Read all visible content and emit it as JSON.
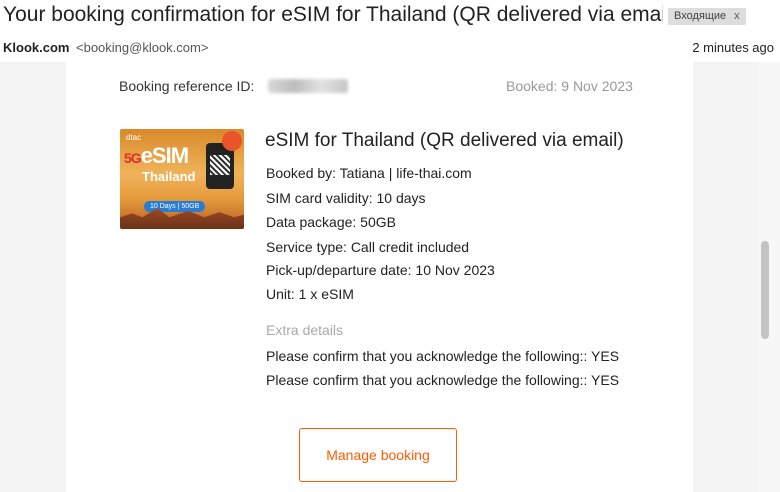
{
  "email": {
    "subject": "Your booking confirmation for eSIM for Thailand (QR delivered via email…",
    "label": "Входящие",
    "label_close": "x",
    "sender_name": "Klook.com",
    "sender_email": "<booking@klook.com>",
    "time": "2 minutes ago"
  },
  "booking": {
    "ref_label": "Booking reference ID:",
    "booked_date": "Booked: 9 Nov 2023",
    "product_title": "eSIM for Thailand (QR delivered via email)",
    "details": [
      "Booked by:  Tatiana | life-thai.com",
      "SIM card validity: 10 days",
      "Data package: 50GB",
      "Service type: Call credit included",
      "Pick-up/departure date: 10 Nov 2023",
      "Unit: 1 x eSIM"
    ],
    "extra_label": "Extra details",
    "extra_items": [
      "Please confirm that you acknowledge the following::  YES",
      "Please confirm that you acknowledge the following::  YES"
    ],
    "manage_label": "Manage booking"
  },
  "product_image": {
    "brand": "dtac",
    "five_g": "5G",
    "esim_text": "eSIM",
    "country": "Thailand",
    "badge": "10 Days | 50GB"
  },
  "colors": {
    "accent": "#ff5b00",
    "muted": "#999999"
  }
}
